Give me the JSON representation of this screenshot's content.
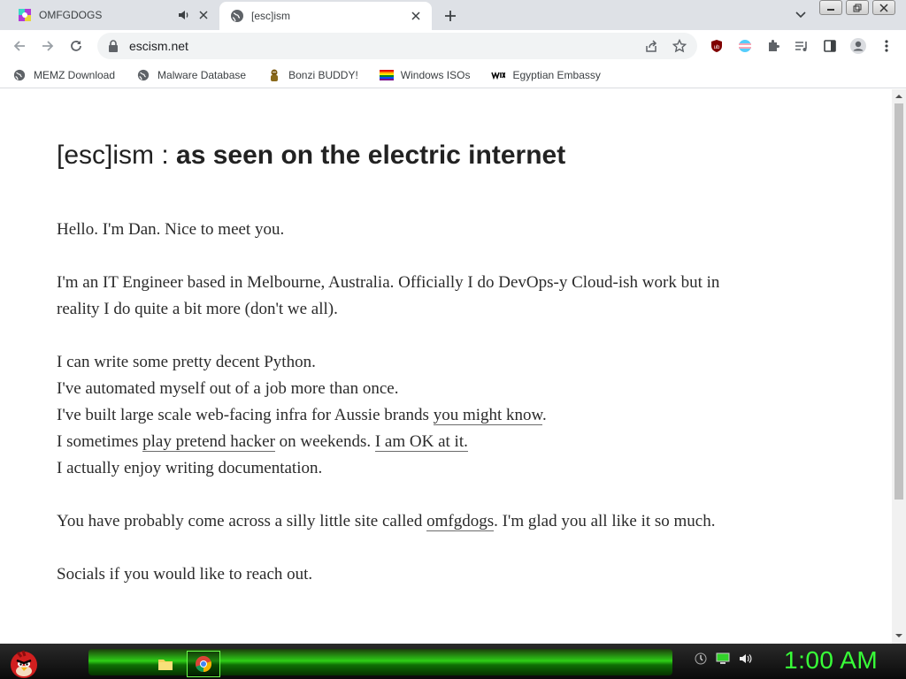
{
  "tabs": [
    {
      "title": "OMFGDOGS",
      "active": false,
      "audio": true
    },
    {
      "title": "[esc]ism",
      "active": true,
      "audio": false
    }
  ],
  "address_bar": {
    "url": "escism.net"
  },
  "bookmarks": [
    {
      "label": "MEMZ Download",
      "icon": "globe-icon"
    },
    {
      "label": "Malware Database",
      "icon": "globe-icon"
    },
    {
      "label": "Bonzi BUDDY!",
      "icon": "bonzi-icon"
    },
    {
      "label": "Windows ISOs",
      "icon": "rainbow-flag-icon"
    },
    {
      "label": "Egyptian Embassy",
      "icon": "wix-icon"
    }
  ],
  "page": {
    "title_brand": "[esc]ism :",
    "title_tagline": "as seen on the electric internet",
    "greeting": "Hello. I'm Dan. Nice to meet you.",
    "intro": "I'm an IT Engineer based in Melbourne, Australia. Officially I do DevOps-y Cloud-ish work but in reality I do quite a bit more (don't we all).",
    "skills": {
      "line1": "I can write some pretty decent Python.",
      "line2": "I've automated myself out of a job more than once.",
      "line3_text": "I've built large scale web-facing infra for Aussie brands ",
      "line3_link": "you might know",
      "line3_end": ".",
      "line4_text": "I sometimes ",
      "line4_link": "play pretend hacker",
      "line4_mid": " on weekends. ",
      "line4_link2": "I am OK at it.",
      "line5": "I actually enjoy writing documentation."
    },
    "omfg_text": "You have probably come across a silly little site called ",
    "omfg_link": "omfgdogs",
    "omfg_end": ". I'm glad you all like it so much.",
    "socials": "Socials if you would like to reach out."
  },
  "taskbar": {
    "clock": "1:00 AM"
  },
  "colors": {
    "tab_strip": "#dee1e6",
    "taskbar_green": "#2ecf17",
    "clock_green": "#38ff38"
  }
}
